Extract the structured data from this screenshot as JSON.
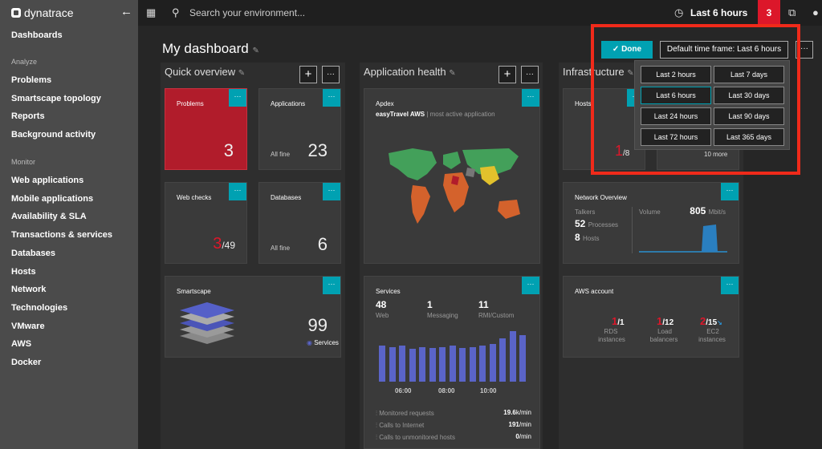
{
  "sidebar": {
    "logo": "dynatrace",
    "top_item": "Dashboards",
    "analyze_label": "Analyze",
    "analyze": [
      "Problems",
      "Smartscape topology",
      "Reports",
      "Background activity"
    ],
    "monitor_label": "Monitor",
    "monitor": [
      "Web applications",
      "Mobile applications",
      "Availability & SLA",
      "Transactions & services",
      "Databases",
      "Hosts",
      "Network",
      "Technologies",
      "VMware",
      "AWS",
      "Docker"
    ]
  },
  "topbar": {
    "search_placeholder": "Search your environment...",
    "time": "Last 6 hours",
    "alerts": "3"
  },
  "page": {
    "title": "My dashboard"
  },
  "columns": [
    "Quick overview",
    "Application health",
    "Infrastructure"
  ],
  "toolbar": {
    "done": "Done",
    "timeframe": "Default time frame: Last 6 hours",
    "more": "···",
    "add": "+"
  },
  "timeframes": [
    "Last 2 hours",
    "Last 7 days",
    "Last 6 hours",
    "Last 30 days",
    "Last 24 hours",
    "Last 90 days",
    "Last 72 hours",
    "Last 365 days"
  ],
  "tiles": {
    "problems": {
      "title": "Problems",
      "value": "3"
    },
    "applications": {
      "title": "Applications",
      "status": "All fine",
      "value": "23"
    },
    "webchecks": {
      "title": "Web checks",
      "value": "3",
      "total": "/49"
    },
    "databases": {
      "title": "Databases",
      "status": "All fine",
      "value": "6"
    },
    "smartscape": {
      "title": "Smartscape",
      "value": "99",
      "label": "Services"
    },
    "apdex": {
      "title": "Apdex",
      "app": "easyTravel AWS",
      "sub": "most active application"
    },
    "services": {
      "title": "Services",
      "web": "48",
      "web_l": "Web",
      "msg": "1",
      "msg_l": "Messaging",
      "rmi": "11",
      "rmi_l": "RMI/Custom",
      "times": [
        "06:00",
        "08:00",
        "10:00"
      ],
      "rows": [
        {
          "label": "Monitored requests",
          "value": "19.6",
          "unit": "k/min"
        },
        {
          "label": "Calls to Internet",
          "value": "191",
          "unit": "/min"
        },
        {
          "label": "Calls to unmonitored hosts",
          "value": "0",
          "unit": "/min"
        }
      ]
    },
    "hosts": {
      "title": "Hosts",
      "value": "1",
      "total": "/8",
      "more": "10 more"
    },
    "network": {
      "title": "Network Overview",
      "talkers": "Talkers",
      "processes": "52",
      "processes_l": "Processes",
      "hosts": "8",
      "hosts_l": "Hosts",
      "volume_l": "Volume",
      "volume": "805",
      "unit": "Mbit/s"
    },
    "aws": {
      "title": "AWS account",
      "rds": "1",
      "rds_t": "/1",
      "rds_l1": "RDS",
      "rds_l2": "instances",
      "lb": "1",
      "lb_t": "/12",
      "lb_l1": "Load",
      "lb_l2": "balancers",
      "ec2": "2",
      "ec2_t": "/15",
      "ec2_l1": "EC2",
      "ec2_l2": "instances"
    }
  },
  "services_bars": [
    0.5,
    0.48,
    0.5,
    0.45,
    0.48,
    0.47,
    0.48,
    0.5,
    0.47,
    0.48,
    0.5,
    0.52,
    0.6,
    0.7,
    0.64
  ]
}
